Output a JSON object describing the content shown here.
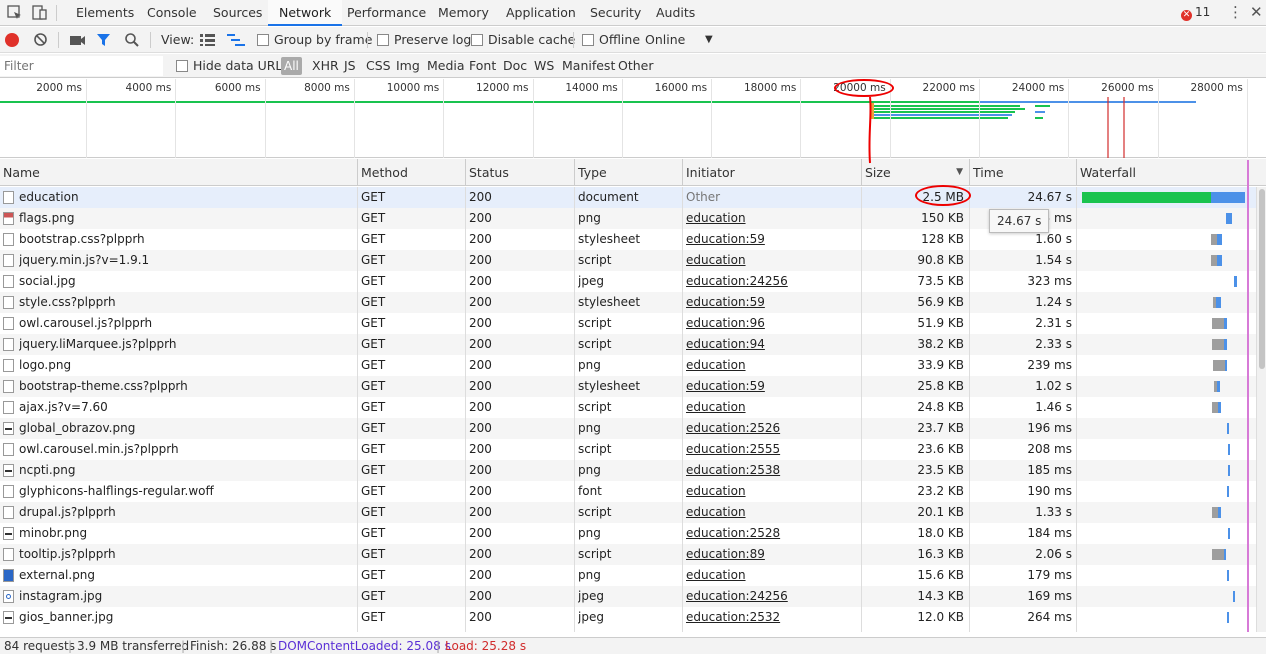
{
  "tabs": [
    "Elements",
    "Console",
    "Sources",
    "Network",
    "Performance",
    "Memory",
    "Application",
    "Security",
    "Audits"
  ],
  "active_tab": "Network",
  "error_count": "11",
  "toolbar": {
    "view_label": "View:",
    "group_by_frame": "Group by frame",
    "preserve_log": "Preserve log",
    "disable_cache": "Disable cache",
    "offline": "Offline",
    "throttle": "Online"
  },
  "filter": {
    "placeholder": "Filter",
    "hide_data_urls": "Hide data URLs",
    "types": [
      "All",
      "XHR",
      "JS",
      "CSS",
      "Img",
      "Media",
      "Font",
      "Doc",
      "WS",
      "Manifest",
      "Other"
    ]
  },
  "overview_ticks": [
    "2000 ms",
    "4000 ms",
    "6000 ms",
    "8000 ms",
    "10000 ms",
    "12000 ms",
    "14000 ms",
    "16000 ms",
    "18000 ms",
    "20000 ms",
    "22000 ms",
    "24000 ms",
    "26000 ms",
    "28000 ms"
  ],
  "columns": [
    "Name",
    "Method",
    "Status",
    "Type",
    "Initiator",
    "Size",
    "Time",
    "Waterfall"
  ],
  "rows": [
    {
      "name": "education",
      "method": "GET",
      "status": "200",
      "type": "document",
      "initiator": "Other",
      "size": "2.5 MB",
      "time": "24.67 s"
    },
    {
      "name": "flags.png",
      "method": "GET",
      "status": "200",
      "type": "png",
      "initiator": "education",
      "size": "150 KB",
      "time": "75 ms"
    },
    {
      "name": "bootstrap.css?plpprh",
      "method": "GET",
      "status": "200",
      "type": "stylesheet",
      "initiator": "education:59",
      "size": "128 KB",
      "time": "1.60 s"
    },
    {
      "name": "jquery.min.js?v=1.9.1",
      "method": "GET",
      "status": "200",
      "type": "script",
      "initiator": "education",
      "size": "90.8 KB",
      "time": "1.54 s"
    },
    {
      "name": "social.jpg",
      "method": "GET",
      "status": "200",
      "type": "jpeg",
      "initiator": "education:24256",
      "size": "73.5 KB",
      "time": "323 ms"
    },
    {
      "name": "style.css?plpprh",
      "method": "GET",
      "status": "200",
      "type": "stylesheet",
      "initiator": "education:59",
      "size": "56.9 KB",
      "time": "1.24 s"
    },
    {
      "name": "owl.carousel.js?plpprh",
      "method": "GET",
      "status": "200",
      "type": "script",
      "initiator": "education:96",
      "size": "51.9 KB",
      "time": "2.31 s"
    },
    {
      "name": "jquery.liMarquee.js?plpprh",
      "method": "GET",
      "status": "200",
      "type": "script",
      "initiator": "education:94",
      "size": "38.2 KB",
      "time": "2.33 s"
    },
    {
      "name": "logo.png",
      "method": "GET",
      "status": "200",
      "type": "png",
      "initiator": "education",
      "size": "33.9 KB",
      "time": "239 ms"
    },
    {
      "name": "bootstrap-theme.css?plpprh",
      "method": "GET",
      "status": "200",
      "type": "stylesheet",
      "initiator": "education:59",
      "size": "25.8 KB",
      "time": "1.02 s"
    },
    {
      "name": "ajax.js?v=7.60",
      "method": "GET",
      "status": "200",
      "type": "script",
      "initiator": "education",
      "size": "24.8 KB",
      "time": "1.46 s"
    },
    {
      "name": "global_obrazov.png",
      "method": "GET",
      "status": "200",
      "type": "png",
      "initiator": "education:2526",
      "size": "23.7 KB",
      "time": "196 ms"
    },
    {
      "name": "owl.carousel.min.js?plpprh",
      "method": "GET",
      "status": "200",
      "type": "script",
      "initiator": "education:2555",
      "size": "23.6 KB",
      "time": "208 ms"
    },
    {
      "name": "ncpti.png",
      "method": "GET",
      "status": "200",
      "type": "png",
      "initiator": "education:2538",
      "size": "23.5 KB",
      "time": "185 ms"
    },
    {
      "name": "glyphicons-halflings-regular.woff",
      "method": "GET",
      "status": "200",
      "type": "font",
      "initiator": "education",
      "size": "23.2 KB",
      "time": "190 ms"
    },
    {
      "name": "drupal.js?plpprh",
      "method": "GET",
      "status": "200",
      "type": "script",
      "initiator": "education",
      "size": "20.1 KB",
      "time": "1.33 s"
    },
    {
      "name": "minobr.png",
      "method": "GET",
      "status": "200",
      "type": "png",
      "initiator": "education:2528",
      "size": "18.0 KB",
      "time": "184 ms"
    },
    {
      "name": "tooltip.js?plpprh",
      "method": "GET",
      "status": "200",
      "type": "script",
      "initiator": "education:89",
      "size": "16.3 KB",
      "time": "2.06 s"
    },
    {
      "name": "external.png",
      "method": "GET",
      "status": "200",
      "type": "png",
      "initiator": "education",
      "size": "15.6 KB",
      "time": "179 ms"
    },
    {
      "name": "instagram.jpg",
      "method": "GET",
      "status": "200",
      "type": "jpeg",
      "initiator": "education:24256",
      "size": "14.3 KB",
      "time": "169 ms"
    },
    {
      "name": "gios_banner.jpg",
      "method": "GET",
      "status": "200",
      "type": "jpeg",
      "initiator": "education:2532",
      "size": "12.0 KB",
      "time": "264 ms"
    }
  ],
  "tooltip": "24.67 s",
  "status": {
    "requests": "84 requests",
    "transferred": "3.9 MB transferred",
    "finish": "Finish: 26.88 s",
    "dom_content_loaded": "DOMContentLoaded: 25.08 s",
    "load": "Load: 25.28 s"
  },
  "colors": {
    "dom_content_loaded": "#5a2fd6",
    "load": "#d12c2c",
    "waiting": "#19c34f",
    "download": "#4c91e8",
    "annotation": "#e00000"
  }
}
